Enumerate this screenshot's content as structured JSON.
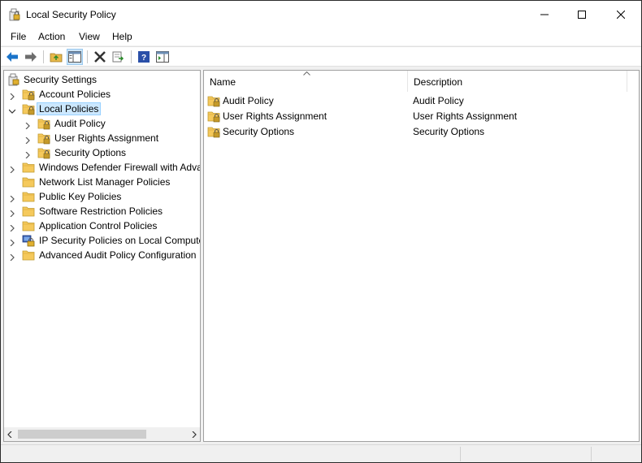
{
  "window": {
    "title": "Local Security Policy"
  },
  "menu": [
    "File",
    "Action",
    "View",
    "Help"
  ],
  "icons": {
    "app": "security-policy-icon",
    "minimize": "minimize-icon",
    "maximize": "maximize-icon",
    "close": "close-icon",
    "folder": "folder-icon",
    "locked_folder": "locked-folder-icon"
  },
  "toolbar": {
    "buttons": [
      "back",
      "forward",
      "up-one-level",
      "show-hide-console-tree",
      "delete",
      "export-list",
      "help",
      "show-hide-action-pane"
    ]
  },
  "tree": {
    "root": "Security Settings",
    "items": [
      {
        "label": "Account Policies",
        "level": 1,
        "expander": "collapsed",
        "icon": "locked-folder"
      },
      {
        "label": "Local Policies",
        "level": 1,
        "expander": "expanded",
        "icon": "locked-folder",
        "selected": true
      },
      {
        "label": "Audit Policy",
        "level": 2,
        "expander": "collapsed",
        "icon": "locked-folder"
      },
      {
        "label": "User Rights Assignment",
        "level": 2,
        "expander": "collapsed",
        "icon": "locked-folder"
      },
      {
        "label": "Security Options",
        "level": 2,
        "expander": "collapsed",
        "icon": "locked-folder"
      },
      {
        "label": "Windows Defender Firewall with Adva",
        "level": 1,
        "expander": "collapsed",
        "icon": "folder"
      },
      {
        "label": "Network List Manager Policies",
        "level": 1,
        "expander": "none",
        "icon": "folder"
      },
      {
        "label": "Public Key Policies",
        "level": 1,
        "expander": "collapsed",
        "icon": "folder"
      },
      {
        "label": "Software Restriction Policies",
        "level": 1,
        "expander": "collapsed",
        "icon": "folder"
      },
      {
        "label": "Application Control Policies",
        "level": 1,
        "expander": "collapsed",
        "icon": "folder"
      },
      {
        "label": "IP Security Policies on Local Compute",
        "level": 1,
        "expander": "collapsed",
        "icon": "ipsec"
      },
      {
        "label": "Advanced Audit Policy Configuration",
        "level": 1,
        "expander": "collapsed",
        "icon": "folder"
      }
    ]
  },
  "list": {
    "columns": [
      "Name",
      "Description"
    ],
    "rows": [
      {
        "name": "Audit Policy",
        "description": "Audit Policy"
      },
      {
        "name": "User Rights Assignment",
        "description": "User Rights Assignment"
      },
      {
        "name": "Security Options",
        "description": "Security Options"
      }
    ]
  },
  "colors": {
    "selection": "#cce8ff",
    "folder": "#f5c95c",
    "lock": "#c59a2a",
    "back_arrow": "#1a73c9"
  }
}
